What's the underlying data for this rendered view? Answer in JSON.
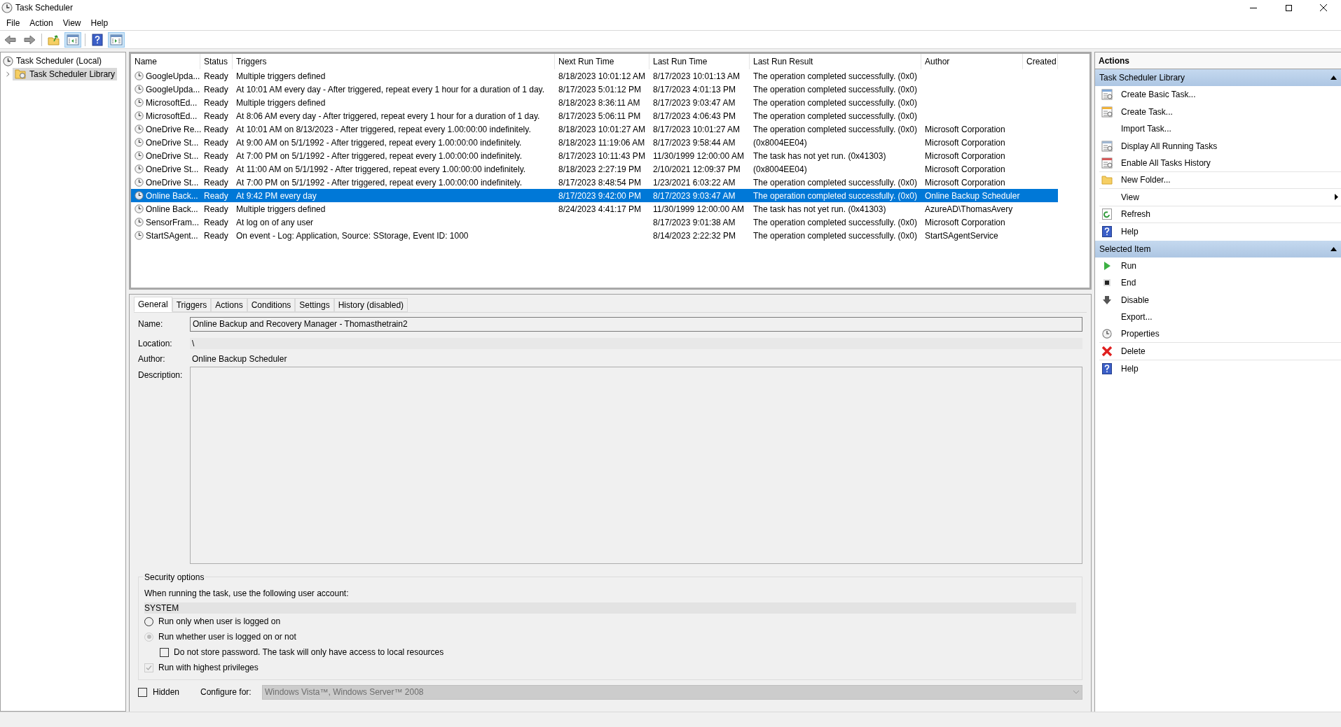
{
  "window": {
    "title": "Task Scheduler"
  },
  "menu": [
    "File",
    "Action",
    "View",
    "Help"
  ],
  "toolbar": [
    {
      "pressed": false
    },
    {
      "pressed": false
    },
    {
      "pressed": false
    },
    {
      "pressed": true
    },
    {
      "pressed": false
    },
    {
      "pressed": true
    }
  ],
  "tree": {
    "label": "Task Scheduler (Local)",
    "children": [
      {
        "label": "Task Scheduler Library",
        "selected": true,
        "expanded": false
      }
    ]
  },
  "table": {
    "columns": [
      "Name",
      "Status",
      "Triggers",
      "Next Run Time",
      "Last Run Time",
      "Last Run Result",
      "Author",
      "Created"
    ],
    "rows": [
      {
        "selected": false,
        "cells": [
          "GoogleUpda...",
          "Ready",
          "Multiple triggers defined",
          "8/18/2023 10:01:12 AM",
          "8/17/2023 10:01:13 AM",
          "The operation completed successfully. (0x0)",
          ""
        ]
      },
      {
        "selected": false,
        "cells": [
          "GoogleUpda...",
          "Ready",
          "At 10:01 AM every day - After triggered, repeat every 1 hour for a duration of 1 day.",
          "8/17/2023 5:01:12 PM",
          "8/17/2023 4:01:13 PM",
          "The operation completed successfully. (0x0)",
          ""
        ]
      },
      {
        "selected": false,
        "cells": [
          "MicrosoftEd...",
          "Ready",
          "Multiple triggers defined",
          "8/18/2023 8:36:11 AM",
          "8/17/2023 9:03:47 AM",
          "The operation completed successfully. (0x0)",
          ""
        ]
      },
      {
        "selected": false,
        "cells": [
          "MicrosoftEd...",
          "Ready",
          "At 8:06 AM every day - After triggered, repeat every 1 hour for a duration of 1 day.",
          "8/17/2023 5:06:11 PM",
          "8/17/2023 4:06:43 PM",
          "The operation completed successfully. (0x0)",
          ""
        ]
      },
      {
        "selected": false,
        "cells": [
          "OneDrive Re...",
          "Ready",
          "At 10:01 AM on 8/13/2023 - After triggered, repeat every 1.00:00:00 indefinitely.",
          "8/18/2023 10:01:27 AM",
          "8/17/2023 10:01:27 AM",
          "The operation completed successfully. (0x0)",
          "Microsoft Corporation"
        ]
      },
      {
        "selected": false,
        "cells": [
          "OneDrive St...",
          "Ready",
          "At 9:00 AM on 5/1/1992 - After triggered, repeat every 1.00:00:00 indefinitely.",
          "8/18/2023 11:19:06 AM",
          "8/17/2023 9:58:44 AM",
          "(0x8004EE04)",
          "Microsoft Corporation"
        ]
      },
      {
        "selected": false,
        "cells": [
          "OneDrive St...",
          "Ready",
          "At 7:00 PM on 5/1/1992 - After triggered, repeat every 1.00:00:00 indefinitely.",
          "8/17/2023 10:11:43 PM",
          "11/30/1999 12:00:00 AM",
          "The task has not yet run. (0x41303)",
          "Microsoft Corporation"
        ]
      },
      {
        "selected": false,
        "cells": [
          "OneDrive St...",
          "Ready",
          "At 11:00 AM on 5/1/1992 - After triggered, repeat every 1.00:00:00 indefinitely.",
          "8/18/2023 2:27:19 PM",
          "2/10/2021 12:09:37 PM",
          "(0x8004EE04)",
          "Microsoft Corporation"
        ]
      },
      {
        "selected": false,
        "cells": [
          "OneDrive St...",
          "Ready",
          "At 7:00 PM on 5/1/1992 - After triggered, repeat every 1.00:00:00 indefinitely.",
          "8/17/2023 8:48:54 PM",
          "1/23/2021 6:03:22 AM",
          "The operation completed successfully. (0x0)",
          "Microsoft Corporation"
        ]
      },
      {
        "selected": true,
        "cells": [
          "Online Back...",
          "Ready",
          "At 9:42 PM every day",
          "8/17/2023 9:42:00 PM",
          "8/17/2023 9:03:47 AM",
          "The operation completed successfully. (0x0)",
          "Online Backup Scheduler"
        ]
      },
      {
        "selected": false,
        "cells": [
          "Online Back...",
          "Ready",
          "Multiple triggers defined",
          "8/24/2023 4:41:17 PM",
          "11/30/1999 12:00:00 AM",
          "The task has not yet run. (0x41303)",
          "AzureAD\\ThomasAvery"
        ]
      },
      {
        "selected": false,
        "cells": [
          "SensorFram...",
          "Ready",
          "At log on of any user",
          "",
          "8/17/2023 9:01:38 AM",
          "The operation completed successfully. (0x0)",
          "Microsoft Corporation"
        ]
      },
      {
        "selected": false,
        "cells": [
          "StartSAgent...",
          "Ready",
          "On event - Log: Application, Source: SStorage, Event ID: 1000",
          "",
          "8/14/2023 2:22:32 PM",
          "The operation completed successfully. (0x0)",
          "StartSAgentService"
        ]
      }
    ]
  },
  "detail_tabs": [
    {
      "label": "General",
      "selected": true
    },
    {
      "label": "Triggers",
      "selected": false
    },
    {
      "label": "Actions",
      "selected": false
    },
    {
      "label": "Conditions",
      "selected": false
    },
    {
      "label": "Settings",
      "selected": false
    },
    {
      "label": "History (disabled)",
      "selected": false
    }
  ],
  "general": {
    "name_label": "Name:",
    "name_value": "Online Backup and Recovery Manager - Thomasthetrain2",
    "location_label": "Location:",
    "location_value": "\\",
    "author_label": "Author:",
    "author_value": "Online Backup Scheduler",
    "description_label": "Description:",
    "security": {
      "title": "Security options",
      "account_label": "When running the task, use the following user account:",
      "account": "SYSTEM",
      "options": [
        {
          "kind": "radio",
          "label": "Run only when user is logged on",
          "checked": false,
          "disabled": false,
          "indented": false
        },
        {
          "kind": "radio",
          "label": "Run whether user is logged on or not",
          "checked": true,
          "disabled": true,
          "indented": false
        },
        {
          "kind": "checkbox",
          "label": "Do not store password.  The task will only have access to local resources",
          "checked": false,
          "disabled": false,
          "indented": true
        },
        {
          "kind": "checkbox",
          "label": "Run with highest privileges",
          "checked": true,
          "disabled": true,
          "indented": false
        }
      ]
    },
    "hidden": {
      "label": "Hidden",
      "checked": false
    },
    "configure_label": "Configure for:",
    "configure_value": "Windows Vista™, Windows Server™ 2008"
  },
  "actions": {
    "title": "Actions",
    "sections": [
      {
        "title": "Task Scheduler Library",
        "expanded": true,
        "items": [
          {
            "label": "Create Basic Task...",
            "divider_below": false,
            "submenu": false
          },
          {
            "label": "Create Task...",
            "divider_below": false,
            "submenu": false
          },
          {
            "label": "Import Task...",
            "divider_below": false,
            "submenu": false
          },
          {
            "label": "Display All Running Tasks",
            "divider_below": false,
            "submenu": false
          },
          {
            "label": "Enable All Tasks History",
            "divider_below": true,
            "submenu": false
          },
          {
            "label": "New Folder...",
            "divider_below": true,
            "submenu": false
          },
          {
            "label": "View",
            "divider_below": true,
            "submenu": true
          },
          {
            "label": "Refresh",
            "divider_below": true,
            "submenu": false
          },
          {
            "label": "Help",
            "divider_below": false,
            "submenu": false
          }
        ]
      },
      {
        "title": "Selected Item",
        "expanded": true,
        "items": [
          {
            "label": "Run",
            "divider_below": false,
            "submenu": false
          },
          {
            "label": "End",
            "divider_below": false,
            "submenu": false
          },
          {
            "label": "Disable",
            "divider_below": false,
            "submenu": false
          },
          {
            "label": "Export...",
            "divider_below": false,
            "submenu": false
          },
          {
            "label": "Properties",
            "divider_below": true,
            "submenu": false
          },
          {
            "label": "Delete",
            "divider_below": true,
            "submenu": false
          },
          {
            "label": "Help",
            "divider_below": false,
            "submenu": false
          }
        ]
      }
    ]
  }
}
